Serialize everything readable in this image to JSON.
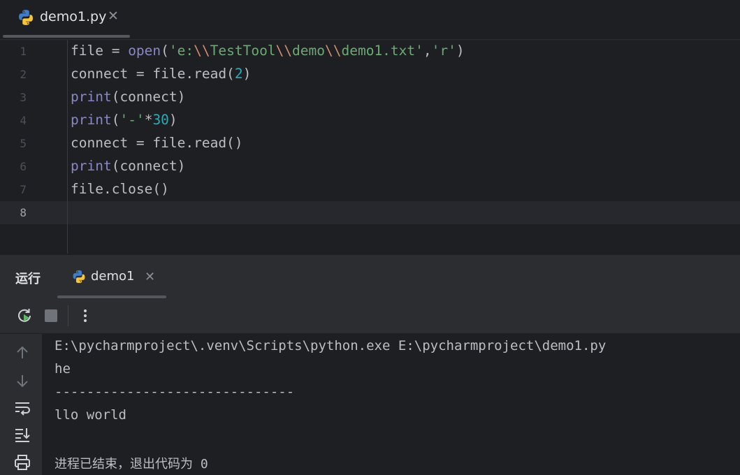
{
  "editor": {
    "tab": {
      "filename": "demo1.py",
      "close_glyph": "✕",
      "icon": "python-icon"
    },
    "lines": [
      {
        "number": "1",
        "tokens": [
          {
            "t": "file = ",
            "c": "plain"
          },
          {
            "t": "open",
            "c": "fn"
          },
          {
            "t": "(",
            "c": "plain"
          },
          {
            "t": "'e:",
            "c": "str"
          },
          {
            "t": "\\\\",
            "c": "esc"
          },
          {
            "t": "TestTool",
            "c": "str"
          },
          {
            "t": "\\\\",
            "c": "esc"
          },
          {
            "t": "demo",
            "c": "str"
          },
          {
            "t": "\\\\",
            "c": "esc"
          },
          {
            "t": "demo1.txt'",
            "c": "str"
          },
          {
            "t": ",",
            "c": "plain"
          },
          {
            "t": "'r'",
            "c": "str"
          },
          {
            "t": ")",
            "c": "plain"
          }
        ]
      },
      {
        "number": "2",
        "tokens": [
          {
            "t": "connect = file.read(",
            "c": "plain"
          },
          {
            "t": "2",
            "c": "num"
          },
          {
            "t": ")",
            "c": "plain"
          }
        ]
      },
      {
        "number": "3",
        "tokens": [
          {
            "t": "print",
            "c": "fn"
          },
          {
            "t": "(connect)",
            "c": "plain"
          }
        ]
      },
      {
        "number": "4",
        "tokens": [
          {
            "t": "print",
            "c": "fn"
          },
          {
            "t": "(",
            "c": "plain"
          },
          {
            "t": "'-'",
            "c": "str"
          },
          {
            "t": "*",
            "c": "plain"
          },
          {
            "t": "30",
            "c": "num"
          },
          {
            "t": ")",
            "c": "plain"
          }
        ]
      },
      {
        "number": "5",
        "tokens": [
          {
            "t": "connect = file.read()",
            "c": "plain"
          }
        ]
      },
      {
        "number": "6",
        "tokens": [
          {
            "t": "print",
            "c": "fn"
          },
          {
            "t": "(connect)",
            "c": "plain"
          }
        ]
      },
      {
        "number": "7",
        "tokens": [
          {
            "t": "file.close()",
            "c": "plain"
          }
        ]
      },
      {
        "number": "8",
        "tokens": []
      }
    ],
    "current_line": "8"
  },
  "run_panel": {
    "title": "运行",
    "tab": {
      "label": "demo1",
      "close_glyph": "✕",
      "icon": "python-icon"
    },
    "toolbar": {
      "rerun": "rerun-icon",
      "stop": "stop-icon",
      "more": "more-vertical-icon"
    },
    "side_tools": [
      "arrow-up-icon",
      "arrow-down-icon",
      "soft-wrap-icon",
      "scroll-to-end-icon",
      "print-icon"
    ],
    "output": [
      "E:\\pycharmproject\\.venv\\Scripts\\python.exe E:\\pycharmproject\\demo1.py",
      "he",
      "------------------------------",
      "llo world",
      "",
      "进程已结束，退出代码为 0"
    ]
  },
  "colors": {
    "background": "#1e1f22",
    "panel": "#2b2d30",
    "text": "#bcbec4",
    "builtin": "#8888c6",
    "string": "#6aab73",
    "escape": "#cf8e6d",
    "number": "#2aacb8"
  }
}
